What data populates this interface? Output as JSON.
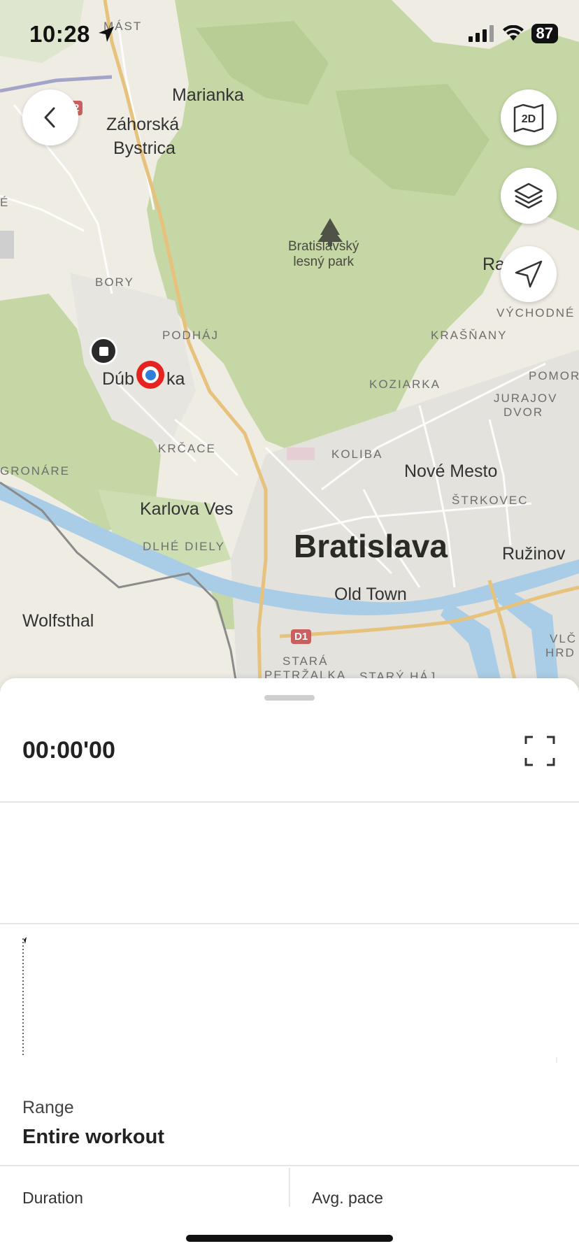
{
  "status_bar": {
    "time": "10:28",
    "battery": "87"
  },
  "map": {
    "labels": {
      "mast": "MÁST",
      "marianka": "Marianka",
      "zahorska": "Záhorská",
      "bystrica": "Bystrica",
      "park_line1": "Bratislavský",
      "park_line2": "lesný park",
      "ra": "Ra",
      "bory": "BORY",
      "vychodne": "VÝCHODNÉ",
      "podhaj": "PODHÁJ",
      "krasnany": "KRAŠŇANY",
      "dubravka_left": "Dúb",
      "dubravka_right": "ka",
      "koziarka": "KOZIARKA",
      "pomor": "POMOR",
      "jurajov": "JURAJOV",
      "dvor": "DVOR",
      "krcace": "KRČACE",
      "koliba": "KOLIBA",
      "gronare": "GRONÁRE",
      "nove_mesto": "Nové Mesto",
      "strkovec": "ŠTRKOVEC",
      "karlova_ves": "Karlova Ves",
      "bratislava": "Bratislava",
      "ruzinov": "Ružinov",
      "dlhe_diely": "DLHÉ DIELY",
      "old_town": "Old Town",
      "wolfsthal": "Wolfsthal",
      "vlc": "VLČ",
      "hrd": "HRD",
      "stara": "STARÁ",
      "petrzalka": "PETRŽALKA",
      "stary_haj": "STARÝ HÁJ",
      "e_edge": "É"
    },
    "shields": {
      "d1": "D1",
      "two": "2"
    },
    "buttons": {
      "mode_2d": "2D"
    },
    "colors": {
      "forest": "#c4d7a4",
      "land": "#efece4",
      "water": "#a9cde6",
      "highway": "#e7c27c",
      "urban": "#e3e2dd"
    }
  },
  "sheet": {
    "timer": "00:00'00",
    "range_label": "Range",
    "range_value": "Entire workout",
    "stats": {
      "duration_label": "Duration",
      "avg_pace_label": "Avg. pace"
    }
  }
}
